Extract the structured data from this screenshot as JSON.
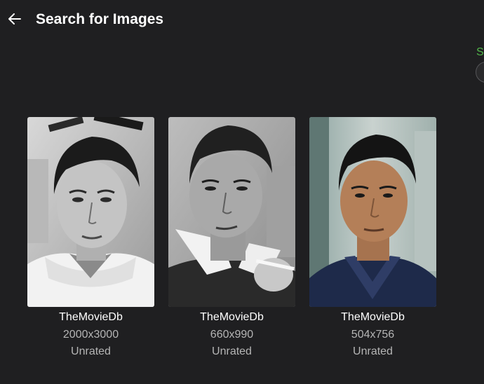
{
  "header": {
    "title": "Search for Images",
    "back_icon": "arrow-left-icon"
  },
  "side": {
    "label": "S"
  },
  "results": [
    {
      "provider": "TheMovieDb",
      "size": "2000x3000",
      "rating": "Unrated",
      "style": "bw-sweater"
    },
    {
      "provider": "TheMovieDb",
      "size": "660x990",
      "rating": "Unrated",
      "style": "bw-cigarette"
    },
    {
      "provider": "TheMovieDb",
      "size": "504x756",
      "rating": "Unrated",
      "style": "color-kimono"
    }
  ],
  "colors": {
    "background": "#1f1f21",
    "accent": "#52b54b",
    "secondary_text": "#b5b5b5"
  }
}
